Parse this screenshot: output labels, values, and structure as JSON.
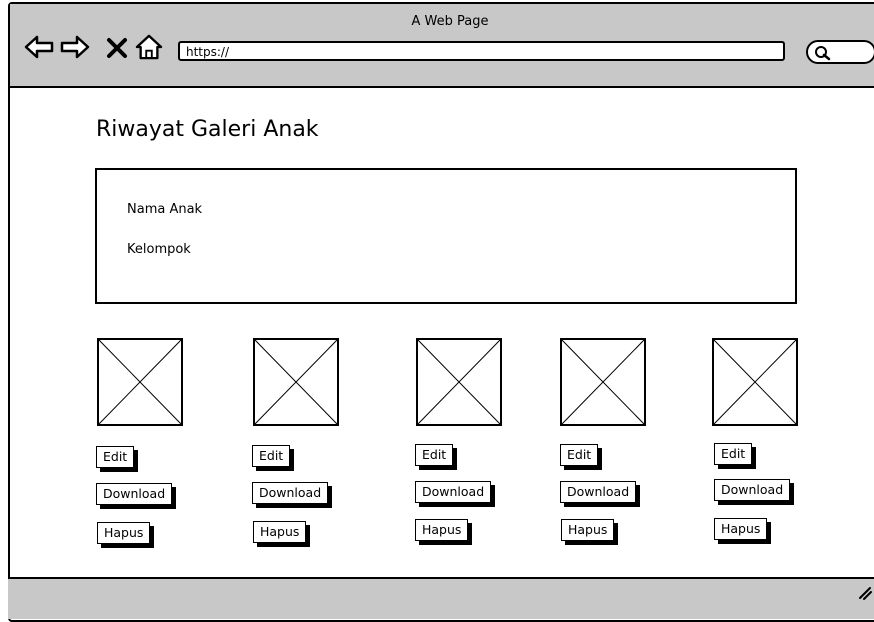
{
  "browser": {
    "title": "A Web Page",
    "address": "https://"
  },
  "page": {
    "title": "Riwayat Galeri Anak",
    "info": {
      "name_label": "Nama Anak",
      "group_label": "Kelompok"
    }
  },
  "gallery": {
    "items": [
      {
        "image": "image-placeholder",
        "edit": "Edit",
        "download": "Download",
        "delete": "Hapus"
      },
      {
        "image": "image-placeholder",
        "edit": "Edit",
        "download": "Download",
        "delete": "Hapus"
      },
      {
        "image": "image-placeholder",
        "edit": "Edit",
        "download": "Download",
        "delete": "Hapus"
      },
      {
        "image": "image-placeholder",
        "edit": "Edit",
        "download": "Download",
        "delete": "Hapus"
      },
      {
        "image": "image-placeholder",
        "edit": "Edit",
        "download": "Download",
        "delete": "Hapus"
      }
    ]
  },
  "colors": {
    "chrome": "#c8c8c8",
    "ink": "#000000",
    "canvas": "#ffffff"
  }
}
